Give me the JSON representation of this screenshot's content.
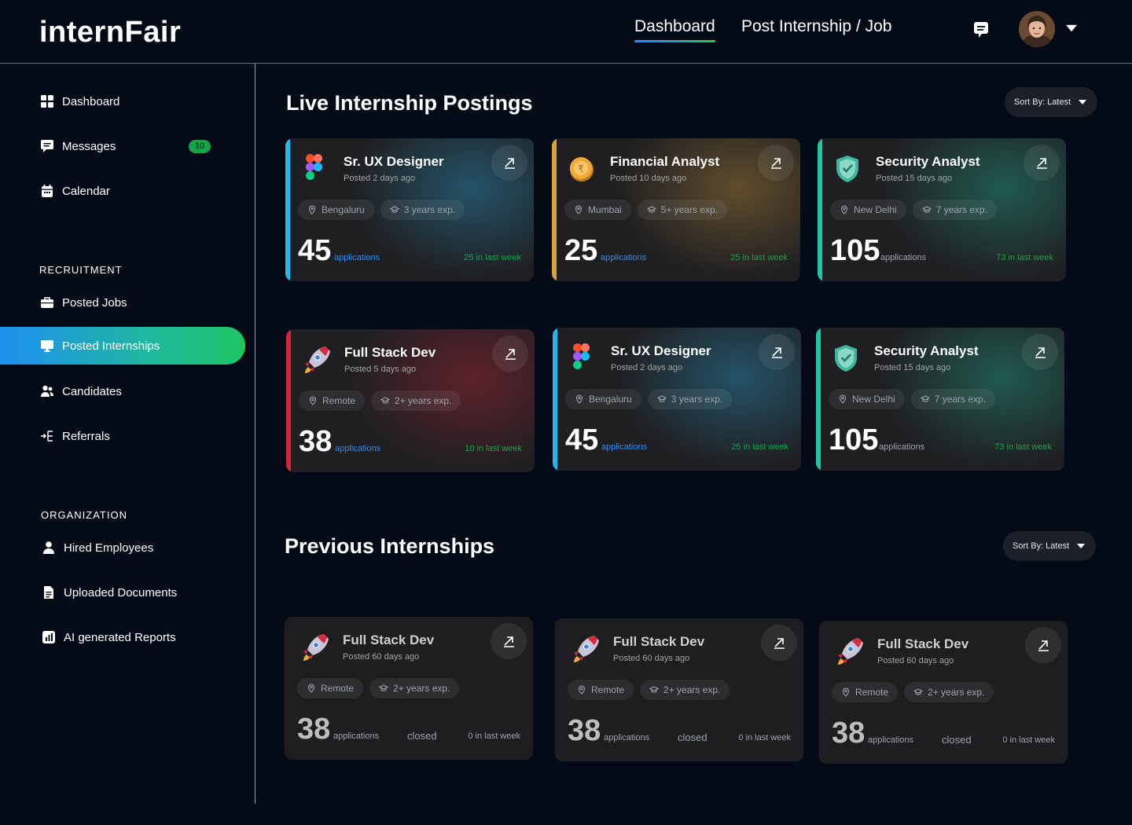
{
  "app": {
    "name": "internFair"
  },
  "header": {
    "tabs": [
      {
        "label": "Dashboard",
        "active": true
      },
      {
        "label": "Post Internship / Job",
        "active": false
      }
    ],
    "icons": [
      "chat-icon",
      "avatar",
      "chevron-down-icon"
    ]
  },
  "sidebar": {
    "main_items": [
      {
        "label": "Dashboard",
        "icon": "grid-icon"
      },
      {
        "label": "Messages",
        "icon": "chat-icon",
        "badge": "10"
      },
      {
        "label": "Calendar",
        "icon": "calendar-icon"
      }
    ],
    "recruitment_title": "RECRUITMENT",
    "recruitment_items": [
      {
        "label": "Posted Jobs",
        "icon": "briefcase-icon"
      },
      {
        "label": "Posted Internships",
        "icon": "monitor-icon",
        "active": true
      },
      {
        "label": "Candidates",
        "icon": "users-icon"
      },
      {
        "label": "Referrals",
        "icon": "referral-icon"
      }
    ],
    "organization_title": "ORGANIZATION",
    "organization_items": [
      {
        "label": "Hired Employees",
        "icon": "user-icon"
      },
      {
        "label": "Uploaded Documents",
        "icon": "document-icon"
      },
      {
        "label": "AI generated  Reports",
        "icon": "report-icon"
      }
    ]
  },
  "live": {
    "title": "Live Internship Postings",
    "sort_label": "Sort By: Latest",
    "cards": [
      {
        "title": "Sr. UX Designer",
        "posted": "Posted 2 days ago",
        "location": "Bengaluru",
        "experience": "3 years exp.",
        "count": "45",
        "count_label": "applications",
        "week": "25 in last week",
        "accent": "#2ab4e8",
        "icon": "figma-icon"
      },
      {
        "title": "Financial Analyst",
        "posted": "Posted 10 days ago",
        "location": "Mumbai",
        "experience": "5+ years exp.",
        "count": "25",
        "count_label": "applications",
        "week": "25 in last week",
        "accent": "#d9a23a",
        "icon": "rupee-coin-icon"
      },
      {
        "title": "Security Analyst",
        "posted": "Posted 15 days ago",
        "location": "New Delhi",
        "experience": "7 years exp.",
        "count": "105",
        "count_label": "applications",
        "week": "73 in last week",
        "accent": "#1fc7a3",
        "icon": "shield-icon"
      },
      {
        "title": "Full Stack Dev",
        "posted": "Posted 5 days ago",
        "location": "Remote",
        "experience": "2+ years exp.",
        "count": "38",
        "count_label": "applications",
        "week": "10 in last week",
        "accent": "#d3263a",
        "icon": "rocket-icon"
      },
      {
        "title": "Sr. UX Designer",
        "posted": "Posted 2 days ago",
        "location": "Bengaluru",
        "experience": "3 years exp.",
        "count": "45",
        "count_label": "applications",
        "week": "25 in last week",
        "accent": "#2ab4e8",
        "icon": "figma-icon"
      },
      {
        "title": "Security Analyst",
        "posted": "Posted 15 days ago",
        "location": "New Delhi",
        "experience": "7 years exp.",
        "count": "105",
        "count_label": "applications",
        "week": "73 in last week",
        "accent": "#1fc7a3",
        "icon": "shield-icon"
      }
    ]
  },
  "previous": {
    "title": "Previous Internships",
    "sort_label": "Sort By: Latest",
    "cards": [
      {
        "title": "Full Stack Dev",
        "posted": "Posted 60 days ago",
        "location": "Remote",
        "experience": "2+ years exp.",
        "count": "38",
        "count_label": "applications",
        "status": "closed",
        "week": "0 in last week",
        "icon": "rocket-icon"
      },
      {
        "title": "Full Stack Dev",
        "posted": "Posted 60 days ago",
        "location": "Remote",
        "experience": "2+ years exp.",
        "count": "38",
        "count_label": "applications",
        "status": "closed",
        "week": "0 in last week",
        "icon": "rocket-icon"
      },
      {
        "title": "Full Stack Dev",
        "posted": "Posted 60 days ago",
        "location": "Remote",
        "experience": "2+ years exp.",
        "count": "38",
        "count_label": "applications",
        "status": "closed",
        "week": "0 in last week",
        "icon": "rocket-icon"
      }
    ]
  }
}
